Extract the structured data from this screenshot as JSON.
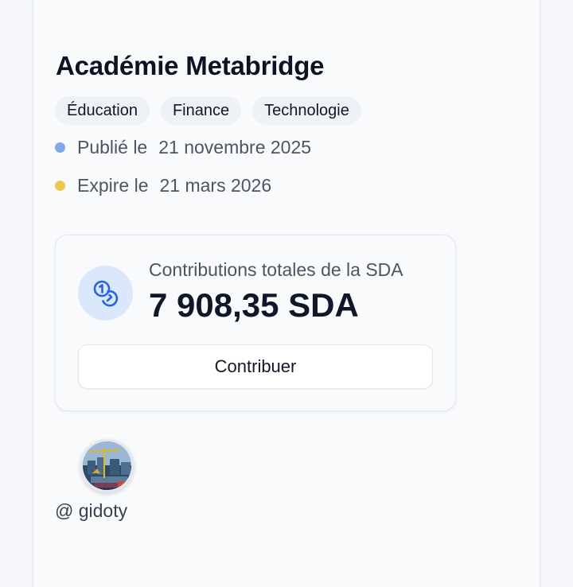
{
  "card": {
    "title": "Académie Metabridge",
    "tags": [
      "Éducation",
      "Finance",
      "Technologie"
    ],
    "published": {
      "label": "Publié le",
      "date": "21 novembre 2025",
      "dot_color": "#7fa8f0"
    },
    "expires": {
      "label": "Expire le",
      "date": "21 mars 2026",
      "dot_color": "#ecc94b"
    }
  },
  "contributions": {
    "icon": "coins-icon",
    "label": "Contributions totales de la SDA",
    "amount": "7 908,35 SDA",
    "button_label": "Contribuer"
  },
  "author": {
    "avatar": "construction-site-photo",
    "handle": "@ gidoty"
  },
  "colors": {
    "accent": "#2563eb",
    "icon_bg": "#dbe7fb"
  }
}
